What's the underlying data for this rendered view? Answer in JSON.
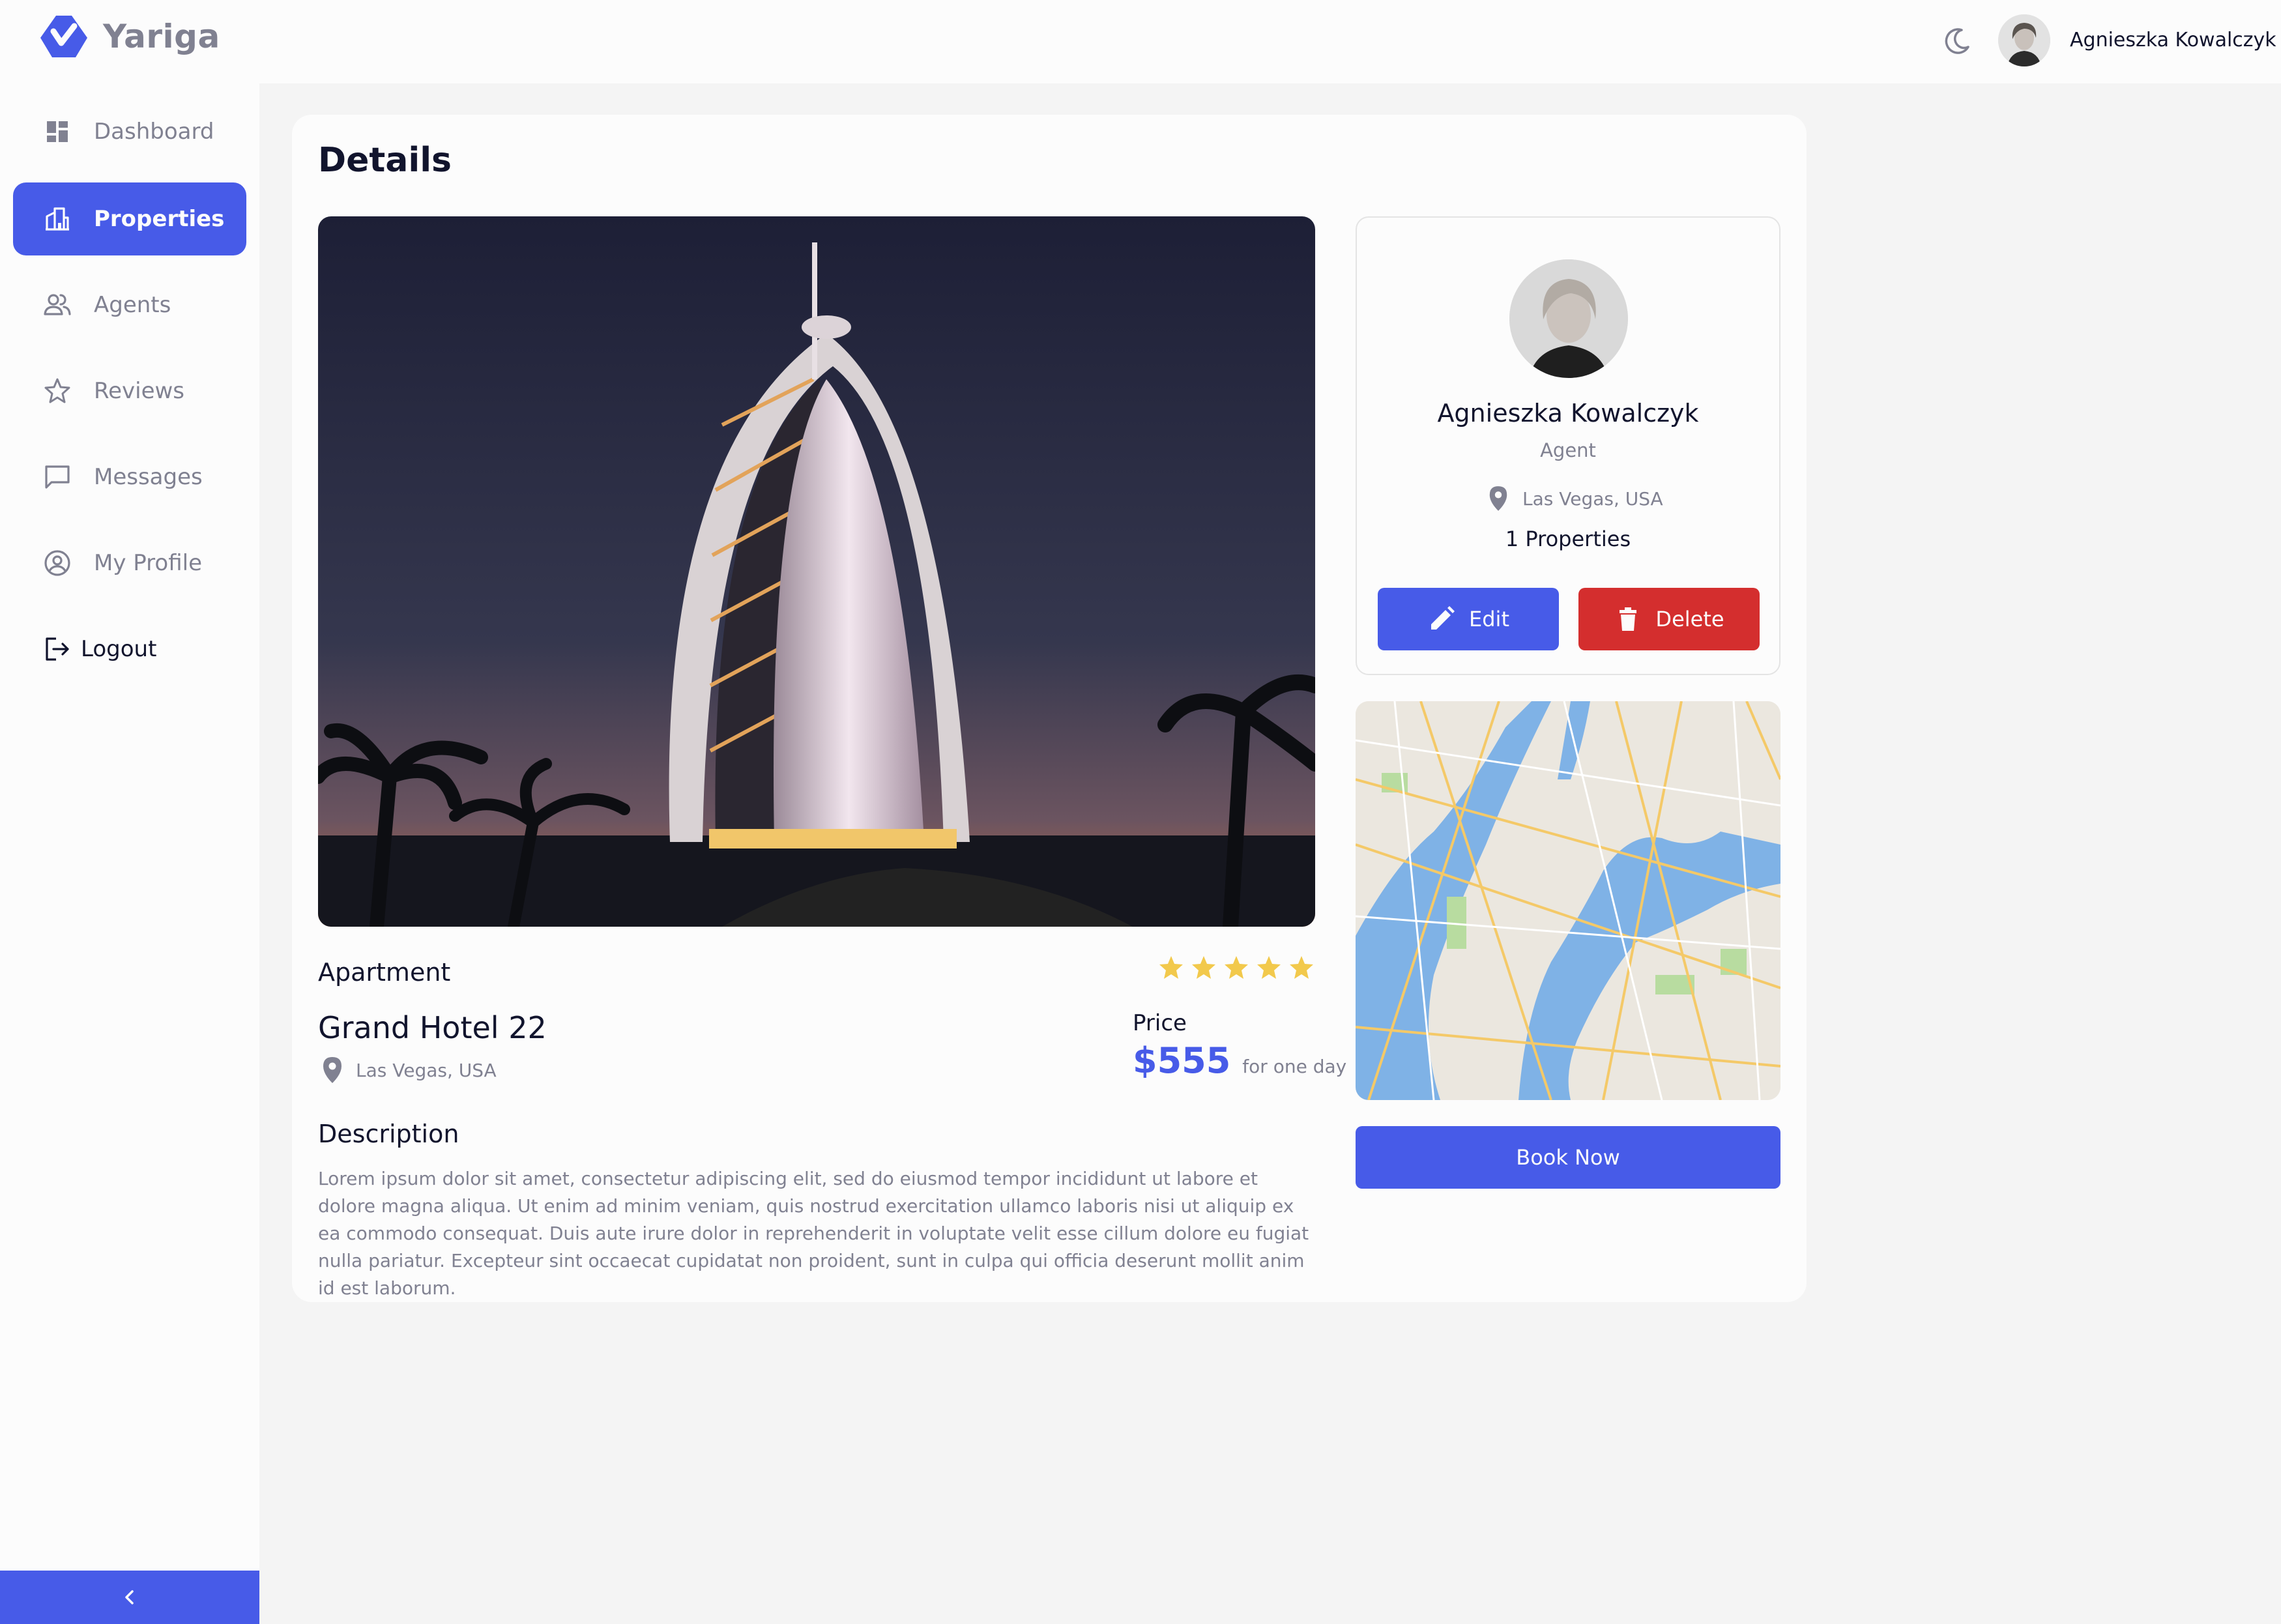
{
  "app": {
    "name": "Yariga"
  },
  "header": {
    "user_name": "Agnieszka Kowalczyk"
  },
  "sidebar": {
    "items": [
      {
        "label": "Dashboard",
        "icon": "dashboard-icon",
        "active": false
      },
      {
        "label": "Properties",
        "icon": "building-icon",
        "active": true
      },
      {
        "label": "Agents",
        "icon": "people-icon",
        "active": false
      },
      {
        "label": "Reviews",
        "icon": "star-outline-icon",
        "active": false
      },
      {
        "label": "Messages",
        "icon": "chat-icon",
        "active": false
      },
      {
        "label": "My Profile",
        "icon": "profile-icon",
        "active": false
      },
      {
        "label": "Logout",
        "icon": "logout-icon",
        "active": false
      }
    ]
  },
  "page": {
    "title": "Details"
  },
  "property": {
    "type": "Apartment",
    "rating": 5,
    "name": "Grand Hotel 22",
    "location": "Las Vegas, USA",
    "price_label": "Price",
    "price": "$555",
    "price_unit": "for one day",
    "description_title": "Description",
    "description": "Lorem ipsum dolor sit amet, consectetur adipiscing elit, sed do eiusmod tempor incididunt ut labore et dolore magna aliqua. Ut enim ad minim veniam, quis nostrud exercitation ullamco laboris nisi ut aliquip ex ea commodo consequat. Duis aute irure dolor in reprehenderit in voluptate velit esse cillum dolore eu fugiat nulla pariatur. Excepteur sint occaecat cupidatat non proident, sunt in culpa qui officia deserunt mollit anim id est laborum."
  },
  "agent": {
    "name": "Agnieszka Kowalczyk",
    "role": "Agent",
    "location": "Las Vegas, USA",
    "properties_count": "1 Properties",
    "edit_label": "Edit",
    "delete_label": "Delete"
  },
  "actions": {
    "book_label": "Book Now"
  },
  "colors": {
    "primary": "#475be8",
    "danger": "#d42e2e",
    "star": "#f2c94c",
    "text_dark": "#11142d",
    "text_muted": "#808191"
  }
}
